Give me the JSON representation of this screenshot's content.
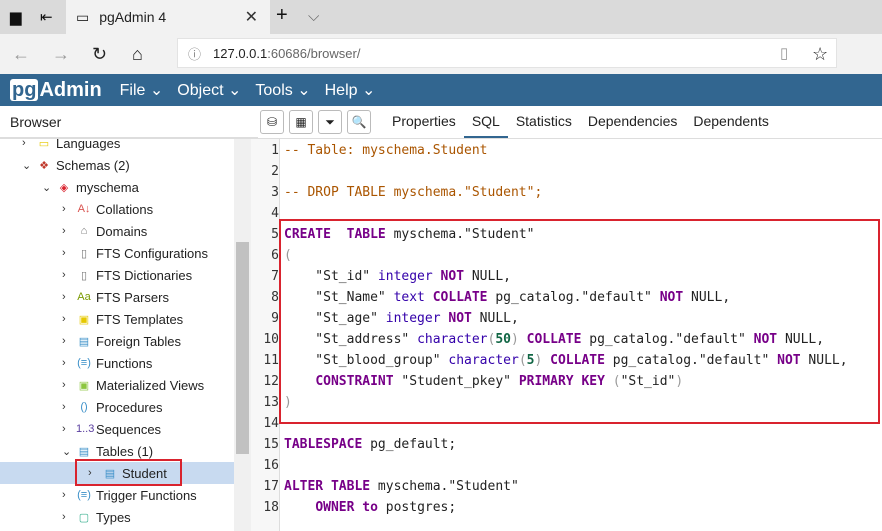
{
  "browser": {
    "tab_title": "pgAdmin 4",
    "url_host": "127.0.0.1",
    "url_path": ":60686/browser/"
  },
  "app": {
    "logo": "pgAdmin",
    "menus": [
      "File",
      "Object",
      "Tools",
      "Help"
    ]
  },
  "panel": {
    "title": "Browser",
    "tabs": [
      "Properties",
      "SQL",
      "Statistics",
      "Dependencies",
      "Dependents"
    ],
    "active_tab": "SQL"
  },
  "tree": [
    {
      "label": "Languages",
      "depth": 1,
      "state": "collapsed",
      "icon": "languages-icon",
      "glyph": "▭",
      "color": "#e6c800"
    },
    {
      "label": "Schemas (2)",
      "depth": 1,
      "state": "expanded",
      "icon": "schemas-icon",
      "glyph": "❖",
      "color": "#c0392b"
    },
    {
      "label": "myschema",
      "depth": 2,
      "state": "expanded",
      "icon": "schema-icon",
      "glyph": "◈",
      "color": "#d9232e"
    },
    {
      "label": "Collations",
      "depth": 3,
      "state": "collapsed",
      "icon": "collations-icon",
      "glyph": "A↓",
      "color": "#d9534f"
    },
    {
      "label": "Domains",
      "depth": 3,
      "state": "collapsed",
      "icon": "domains-icon",
      "glyph": "⌂",
      "color": "#777"
    },
    {
      "label": "FTS Configurations",
      "depth": 3,
      "state": "collapsed",
      "icon": "fts-configurations-icon",
      "glyph": "▯",
      "color": "#777"
    },
    {
      "label": "FTS Dictionaries",
      "depth": 3,
      "state": "collapsed",
      "icon": "fts-dictionaries-icon",
      "glyph": "▯",
      "color": "#777"
    },
    {
      "label": "FTS Parsers",
      "depth": 3,
      "state": "collapsed",
      "icon": "fts-parsers-icon",
      "glyph": "Aa",
      "color": "#7a9a00"
    },
    {
      "label": "FTS Templates",
      "depth": 3,
      "state": "collapsed",
      "icon": "fts-templates-icon",
      "glyph": "▣",
      "color": "#e6c800"
    },
    {
      "label": "Foreign Tables",
      "depth": 3,
      "state": "collapsed",
      "icon": "foreign-tables-icon",
      "glyph": "▤",
      "color": "#3a8fc8"
    },
    {
      "label": "Functions",
      "depth": 3,
      "state": "collapsed",
      "icon": "functions-icon",
      "glyph": "(≡)",
      "color": "#3a8fc8"
    },
    {
      "label": "Materialized Views",
      "depth": 3,
      "state": "collapsed",
      "icon": "materialized-views-icon",
      "glyph": "▣",
      "color": "#8cc63f"
    },
    {
      "label": "Procedures",
      "depth": 3,
      "state": "collapsed",
      "icon": "procedures-icon",
      "glyph": "()",
      "color": "#3a8fc8"
    },
    {
      "label": "Sequences",
      "depth": 3,
      "state": "collapsed",
      "icon": "sequences-icon",
      "glyph": "1..3",
      "color": "#5b3fa0"
    },
    {
      "label": "Tables (1)",
      "depth": 3,
      "state": "expanded",
      "icon": "tables-icon",
      "glyph": "▤",
      "color": "#3a8fc8"
    },
    {
      "label": "Student",
      "depth": 4,
      "state": "collapsed",
      "icon": "table-icon",
      "glyph": "▤",
      "color": "#3a8fc8",
      "selected": true
    },
    {
      "label": "Trigger Functions",
      "depth": 3,
      "state": "collapsed",
      "icon": "trigger-functions-icon",
      "glyph": "(≡)",
      "color": "#3a8fc8"
    },
    {
      "label": "Types",
      "depth": 3,
      "state": "collapsed",
      "icon": "types-icon",
      "glyph": "▢",
      "color": "#3ab08f"
    }
  ],
  "code": [
    [
      [
        "cm",
        "-- Table: myschema.Student"
      ]
    ],
    [],
    [
      [
        "cm",
        "-- DROP TABLE myschema.\"Student\";"
      ]
    ],
    [],
    [
      [
        "kw",
        "CREATE"
      ],
      [
        "",
        "  "
      ],
      [
        "kw",
        "TABLE"
      ],
      [
        "",
        " myschema.\"Student\""
      ]
    ],
    [
      [
        "br",
        "("
      ]
    ],
    [
      [
        "",
        "    \"St_id\" "
      ],
      [
        "ty",
        "integer"
      ],
      [
        "",
        " "
      ],
      [
        "kw",
        "NOT"
      ],
      [
        "",
        " NULL,"
      ]
    ],
    [
      [
        "",
        "    \"St_Name\" "
      ],
      [
        "ty",
        "text"
      ],
      [
        "",
        " "
      ],
      [
        "kw",
        "COLLATE"
      ],
      [
        "",
        " pg_catalog.\"default\" "
      ],
      [
        "kw",
        "NOT"
      ],
      [
        "",
        " NULL,"
      ]
    ],
    [
      [
        "",
        "    \"St_age\" "
      ],
      [
        "ty",
        "integer"
      ],
      [
        "",
        " "
      ],
      [
        "kw",
        "NOT"
      ],
      [
        "",
        " NULL,"
      ]
    ],
    [
      [
        "",
        "    \"St_address\" "
      ],
      [
        "ty",
        "character"
      ],
      [
        "br",
        "("
      ],
      [
        "num",
        "50"
      ],
      [
        "br",
        ")"
      ],
      [
        "",
        " "
      ],
      [
        "kw",
        "COLLATE"
      ],
      [
        "",
        " pg_catalog.\"default\" "
      ],
      [
        "kw",
        "NOT"
      ],
      [
        "",
        " NULL,"
      ]
    ],
    [
      [
        "",
        "    \"St_blood_group\" "
      ],
      [
        "ty",
        "character"
      ],
      [
        "br",
        "("
      ],
      [
        "num",
        "5"
      ],
      [
        "br",
        ")"
      ],
      [
        "",
        " "
      ],
      [
        "kw",
        "COLLATE"
      ],
      [
        "",
        " pg_catalog.\"default\" "
      ],
      [
        "kw",
        "NOT"
      ],
      [
        "",
        " NULL,"
      ]
    ],
    [
      [
        "",
        "    "
      ],
      [
        "kw",
        "CONSTRAINT"
      ],
      [
        "",
        " \"Student_pkey\" "
      ],
      [
        "kw",
        "PRIMARY KEY"
      ],
      [
        "",
        " "
      ],
      [
        "br",
        "("
      ],
      [
        "",
        "\"St_id\""
      ],
      [
        "br",
        ")"
      ]
    ],
    [
      [
        "br",
        ")"
      ]
    ],
    [],
    [
      [
        "kw",
        "TABLESPACE"
      ],
      [
        "",
        " pg_default;"
      ]
    ],
    [],
    [
      [
        "kw",
        "ALTER TABLE"
      ],
      [
        "",
        " myschema.\"Student\""
      ]
    ],
    [
      [
        "",
        "    "
      ],
      [
        "kw",
        "OWNER"
      ],
      [
        "",
        " "
      ],
      [
        "kw",
        "to"
      ],
      [
        "",
        " postgres;"
      ]
    ]
  ]
}
